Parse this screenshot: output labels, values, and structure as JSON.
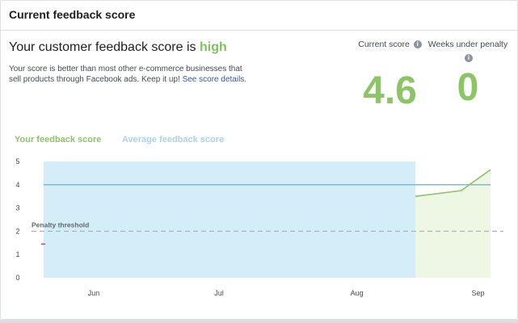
{
  "card": {
    "title": "Current feedback score"
  },
  "summary": {
    "headline_prefix": "Your customer feedback score is ",
    "headline_level": "high",
    "description": "Your score is better than most other e-commerce businesses that sell products through Facebook ads. Keep it up! ",
    "details_link": "See score details."
  },
  "metrics": {
    "current_score_label": "Current score",
    "current_score_value": "4.6",
    "weeks_label": "Weeks under penalty",
    "weeks_value": "0"
  },
  "colors": {
    "your_score": "#8bc565",
    "average_score": "#a9d4e6",
    "penalty_line": "#b0b3b8",
    "area_fill": "#eef6e4"
  },
  "chart_data": {
    "type": "line",
    "legend": [
      "Your feedback score",
      "Average feedback score"
    ],
    "xticks": [
      "Jun",
      "Jul",
      "Aug",
      "Sep"
    ],
    "yticks": [
      "5",
      "4",
      "3",
      "2",
      "1",
      "0"
    ],
    "ylim": [
      0,
      5
    ],
    "grid": false,
    "threshold": {
      "label": "Penalty threshold",
      "value": 2
    },
    "series": [
      {
        "name": "Your feedback score",
        "points": [
          {
            "x": "Aug 21",
            "y": 3.5
          },
          {
            "x": "Sep 1",
            "y": 3.75
          },
          {
            "x": "Sep 8",
            "y": 4.65
          }
        ]
      },
      {
        "name": "Average feedback score",
        "points": [
          {
            "x": "May 24",
            "y": 4.0
          },
          {
            "x": "Sep 8",
            "y": 4.0
          }
        ]
      }
    ],
    "highlight_range": {
      "from": "May 24",
      "to": "Aug 21"
    },
    "marker": {
      "x": "May 24",
      "y": 1.45
    }
  }
}
